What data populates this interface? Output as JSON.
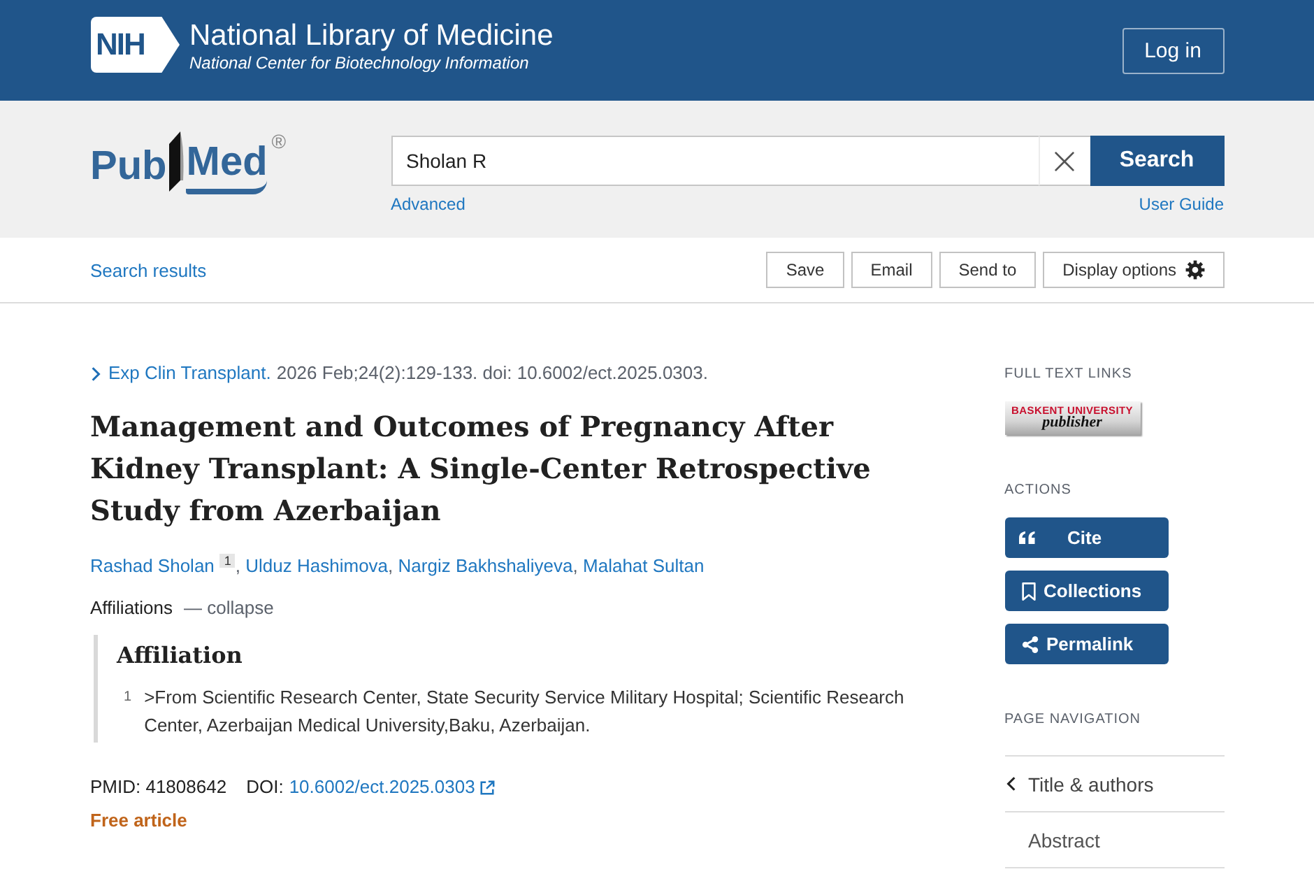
{
  "header": {
    "logo": "NIH",
    "title": "National Library of Medicine",
    "subtitle": "National Center for Biotechnology Information",
    "login_button": "Log in"
  },
  "search_bar": {
    "logo": {
      "parts": [
        "Pub",
        "Med"
      ],
      "mark": "®"
    },
    "query": "Sholan R",
    "search_button": "Search",
    "links": [
      "Advanced",
      "User Guide"
    ]
  },
  "toolbar": {
    "back_link": "Search results",
    "buttons": [
      {
        "label": "Save",
        "kind": "plain"
      },
      {
        "label": "Email",
        "kind": "plain"
      },
      {
        "label": "Send to",
        "kind": "plain"
      },
      {
        "label": "Display options",
        "kind": "settings"
      }
    ]
  },
  "article": {
    "journal": "Exp Clin Transplant.",
    "citation": "2026 Feb;24(2):129-133. doi: 10.6002/ect.2025.0303.",
    "title": "Management and Outcomes of Pregnancy After Kidney Transplant: A Single-Center Retrospective Study from Azerbaijan",
    "authors": [
      {
        "name": "Rashad Sholan",
        "affiliation_ref": "1",
        "separator": ","
      },
      {
        "name": "Ulduz Hashimova",
        "separator": ","
      },
      {
        "name": "Nargiz Bakhshaliyeva",
        "separator": ","
      },
      {
        "name": "Malahat Sultan"
      }
    ],
    "affiliations": {
      "label": "Affiliations",
      "toggle": "— collapse",
      "heading": "Affiliation",
      "items": [
        {
          "number": "1",
          "text": ">From Scientific Research Center, State Security Service Military Hospital; Scientific Research Center, Azerbaijan Medical University,Baku, Azerbaijan."
        }
      ]
    },
    "pmid": "PMID: 41808642",
    "doi_label": "DOI:",
    "doi": "10.6002/ect.2025.0303",
    "free_article": "Free article"
  },
  "sidebar": {
    "full_text_heading": "FULL TEXT LINKS",
    "publisher_logo": [
      "BASKENT UNIVERSITY",
      "publisher"
    ],
    "actions_heading": "ACTIONS",
    "actions": [
      {
        "label": "Cite",
        "kind": "cite"
      },
      {
        "label": "Collections",
        "kind": "collections"
      },
      {
        "label": "Permalink",
        "kind": "permalink"
      }
    ],
    "navigation_heading": "PAGE NAVIGATION",
    "navigation": [
      {
        "label": "Title & authors",
        "selected": true
      },
      {
        "label": "Abstract",
        "selected": false
      }
    ]
  }
}
